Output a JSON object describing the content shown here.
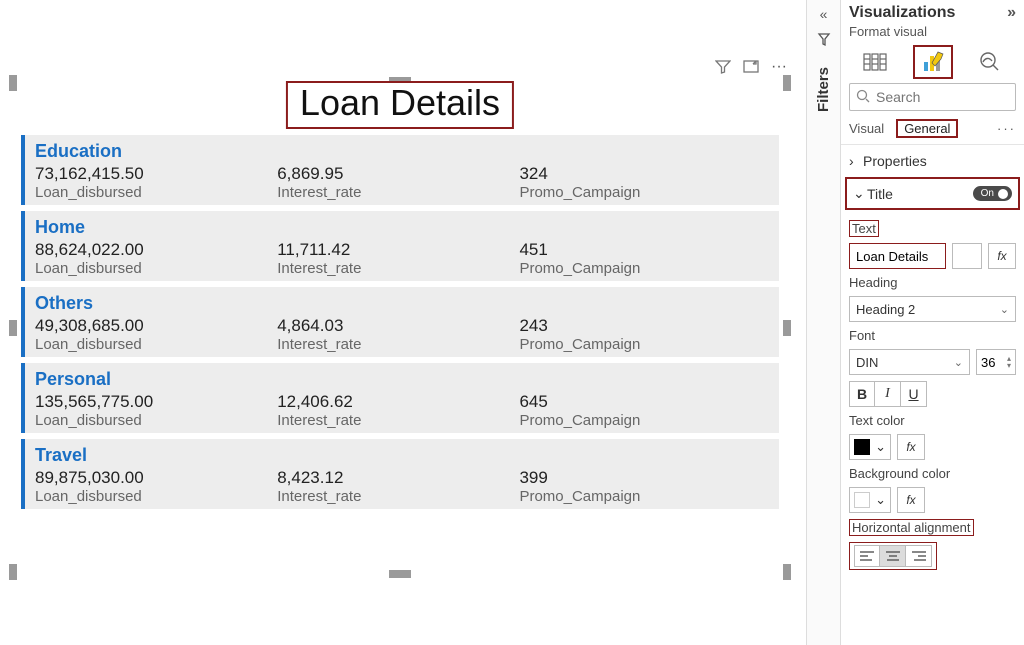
{
  "canvas": {
    "title": "Loan Details",
    "header_icons": [
      "filter",
      "focus",
      "more"
    ],
    "metrics_labels": [
      "Loan_disbursed",
      "Interest_rate",
      "Promo_Campaign"
    ],
    "cards": [
      {
        "category": "Education",
        "values": [
          "73,162,415.50",
          "6,869.95",
          "324"
        ]
      },
      {
        "category": "Home",
        "values": [
          "88,624,022.00",
          "11,711.42",
          "451"
        ]
      },
      {
        "category": "Others",
        "values": [
          "49,308,685.00",
          "4,864.03",
          "243"
        ]
      },
      {
        "category": "Personal",
        "values": [
          "135,565,775.00",
          "12,406.62",
          "645"
        ]
      },
      {
        "category": "Travel",
        "values": [
          "89,875,030.00",
          "8,423.12",
          "399"
        ]
      }
    ]
  },
  "filters_rail": {
    "label": "Filters"
  },
  "viz": {
    "header": "Visualizations",
    "subheader": "Format visual",
    "search_placeholder": "Search",
    "tabs": {
      "visual": "Visual",
      "general": "General"
    },
    "sections": {
      "properties": "Properties",
      "title": {
        "label": "Title",
        "toggle": "On",
        "text_label": "Text",
        "text_value": "Loan Details",
        "heading_label": "Heading",
        "heading_value": "Heading 2",
        "font_label": "Font",
        "font_family": "DIN",
        "font_size": "36",
        "text_color_label": "Text color",
        "bg_color_label": "Background color",
        "halign_label": "Horizontal alignment"
      }
    }
  }
}
